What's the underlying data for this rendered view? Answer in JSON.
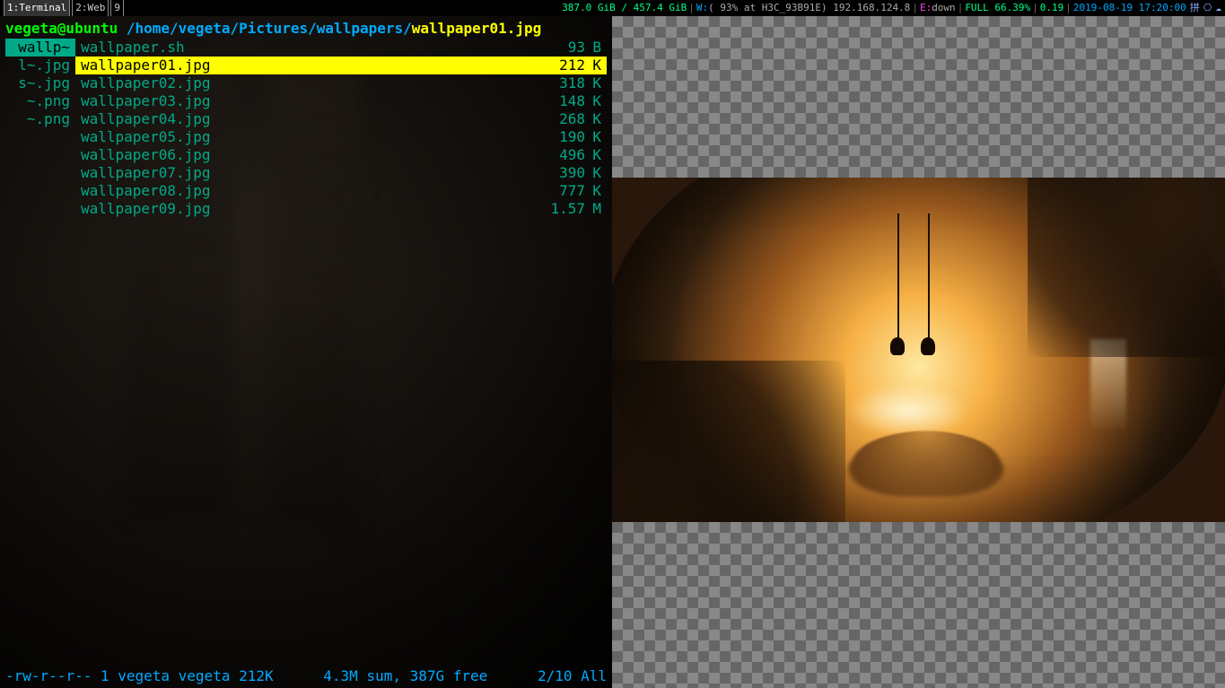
{
  "topbar": {
    "workspaces": [
      {
        "label": "1:Terminal",
        "active": true
      },
      {
        "label": "2:Web",
        "active": false
      },
      {
        "label": "9",
        "active": false
      }
    ],
    "disk": "387.0 GiB / 457.4 GiB",
    "wifi_label": "W:",
    "wifi": "( 93% at H3C_93B91E) 192.168.124.8",
    "eth_label": "E:",
    "eth": "down",
    "battery": "FULL 66.39%",
    "load": "0.19",
    "datetime": "2019-08-19 17:20:00",
    "tray_ime": "拼",
    "tray_globe": "⎔",
    "tray_cloud": "☁"
  },
  "prompt": {
    "user_host": "vegeta@ubuntu",
    "path": " /home/vegeta/Pictures/wallpapers/",
    "current_file": "wallpaper01.jpg"
  },
  "left_col": [
    {
      "text": "wallp~",
      "highlighted": true
    },
    {
      "text": "l~.jpg",
      "highlighted": false
    },
    {
      "text": "s~.jpg",
      "highlighted": false
    },
    {
      "text": "~.png",
      "highlighted": false
    },
    {
      "text": "~.png",
      "highlighted": false
    }
  ],
  "files": [
    {
      "name": "wallpaper.sh",
      "size": "93",
      "unit": "B",
      "selected": false
    },
    {
      "name": "wallpaper01.jpg",
      "size": "212",
      "unit": "K",
      "selected": true
    },
    {
      "name": "wallpaper02.jpg",
      "size": "318",
      "unit": "K",
      "selected": false
    },
    {
      "name": "wallpaper03.jpg",
      "size": "148",
      "unit": "K",
      "selected": false
    },
    {
      "name": "wallpaper04.jpg",
      "size": "268",
      "unit": "K",
      "selected": false
    },
    {
      "name": "wallpaper05.jpg",
      "size": "190",
      "unit": "K",
      "selected": false
    },
    {
      "name": "wallpaper06.jpg",
      "size": "496",
      "unit": "K",
      "selected": false
    },
    {
      "name": "wallpaper07.jpg",
      "size": "390",
      "unit": "K",
      "selected": false
    },
    {
      "name": "wallpaper08.jpg",
      "size": "777",
      "unit": "K",
      "selected": false
    },
    {
      "name": "wallpaper09.jpg",
      "size": "1.57",
      "unit": "M",
      "selected": false
    }
  ],
  "status": {
    "permissions": "-rw-r--r-- 1 vegeta vegeta 212K",
    "summary": "4.3M sum, 387G free",
    "position": "2/10  All"
  }
}
